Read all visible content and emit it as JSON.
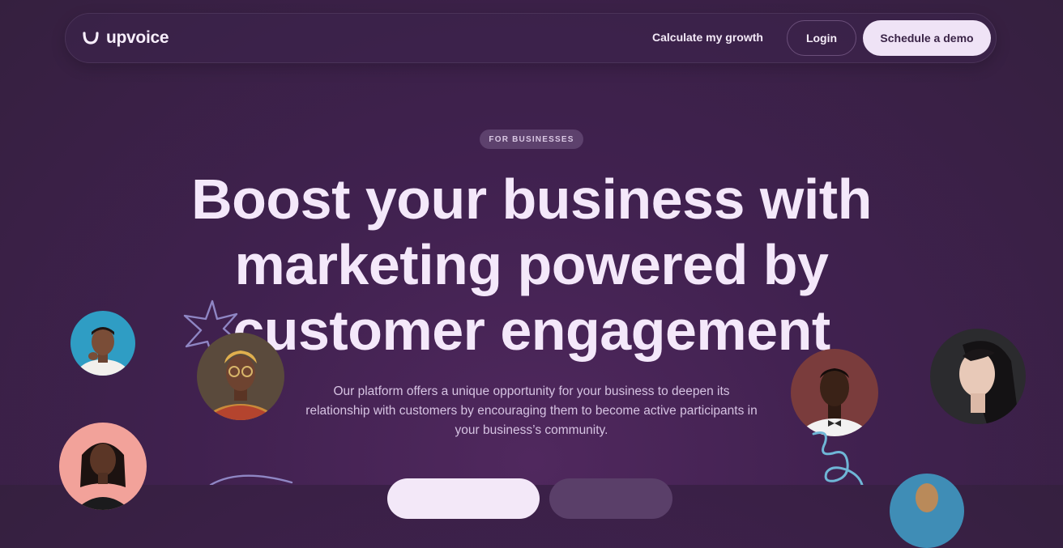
{
  "brand": {
    "name": "upvoice"
  },
  "nav": {
    "calculate_label": "Calculate my growth",
    "login_label": "Login",
    "demo_label": "Schedule a demo"
  },
  "hero": {
    "badge": "FOR BUSINESSES",
    "headline": "Boost your business with marketing powered by customer engagement",
    "subtitle": "Our platform offers a unique opportunity for your business to deepen its relationship with customers by encouraging them to become active participants in your business’s community."
  },
  "colors": {
    "background": "#40214f",
    "accent_light": "#efe3f6",
    "badge_bg": "#5d416d",
    "doodle_blue": "#6fb6d6",
    "doodle_purple": "#8f86c4"
  },
  "icons": [
    "logo-smile-icon",
    "star-burst-doodle",
    "squiggle-doodle"
  ]
}
